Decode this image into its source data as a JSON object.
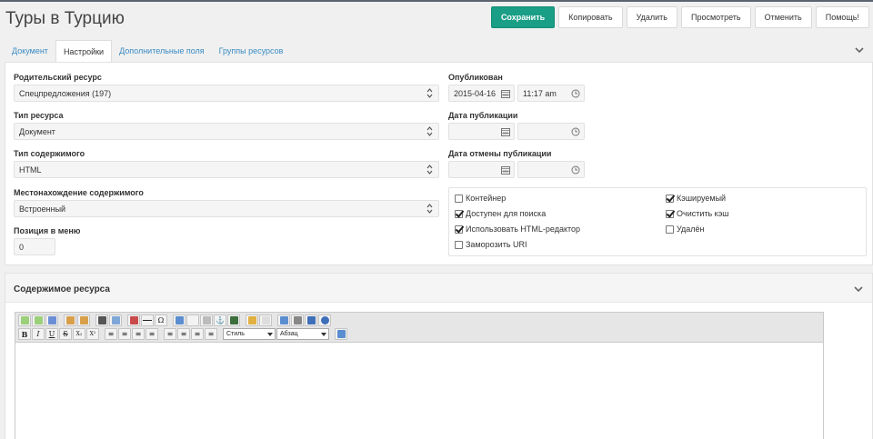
{
  "header": {
    "title": "Туры в Турцию",
    "buttons": {
      "save": "Сохранить",
      "copy": "Копировать",
      "delete": "Удалить",
      "view": "Просмотреть",
      "cancel": "Отменить",
      "help": "Помощь!"
    }
  },
  "tabs": [
    {
      "label": "Документ",
      "active": false
    },
    {
      "label": "Настройки",
      "active": true
    },
    {
      "label": "Дополнительные поля",
      "active": false
    },
    {
      "label": "Группы ресурсов",
      "active": false
    }
  ],
  "settings": {
    "parent": {
      "label": "Родительский ресурс",
      "value": "Спецпредложения (197)"
    },
    "class": {
      "label": "Тип ресурса",
      "value": "Документ"
    },
    "content_type": {
      "label": "Тип содержимого",
      "value": "HTML"
    },
    "disposition": {
      "label": "Местонахождение содержимого",
      "value": "Встроенный"
    },
    "menuindex": {
      "label": "Позиция в меню",
      "value": "0"
    },
    "publishedon": {
      "label": "Опубликован",
      "date": "2015-04-16",
      "time": "11:17 am"
    },
    "pub_date": {
      "label": "Дата публикации",
      "date": "",
      "time": ""
    },
    "unpub_date": {
      "label": "Дата отмены публикации",
      "date": "",
      "time": ""
    }
  },
  "checkboxes": [
    {
      "label": "Контейнер",
      "checked": false
    },
    {
      "label": "Доступен для поиска",
      "checked": true
    },
    {
      "label": "Использовать HTML-редактор",
      "checked": true
    },
    {
      "label": "Заморозить URI",
      "checked": false
    },
    {
      "label": "Кэшируемый",
      "checked": true
    },
    {
      "label": "Очистить кэш",
      "checked": true
    },
    {
      "label": "Удалён",
      "checked": false
    }
  ],
  "content_section": {
    "title": "Содержимое ресурса",
    "toolbar": {
      "bold": "B",
      "italic": "I",
      "underline": "U",
      "strike": "S",
      "sub": "X₂",
      "sup": "X²",
      "style_select": "Стиль",
      "format_select": "Абзац"
    }
  },
  "colors": {
    "accent": "#1a9e86",
    "link": "#3a8cc4"
  }
}
